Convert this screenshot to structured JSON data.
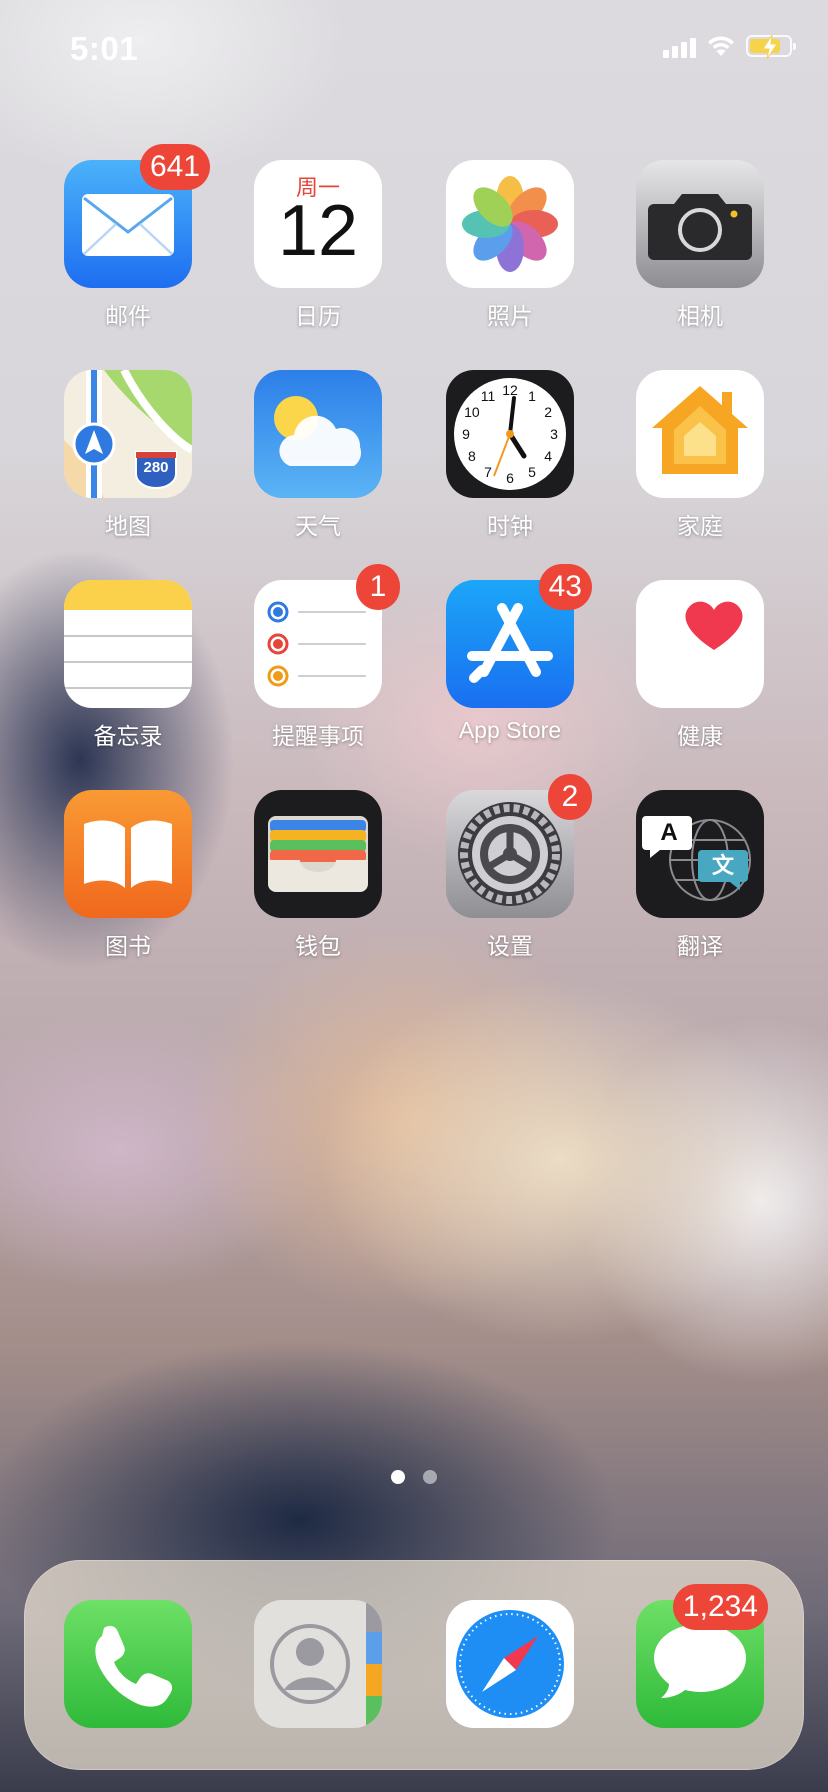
{
  "status_bar": {
    "time": "5:01"
  },
  "grid_apps": [
    {
      "label": "邮件",
      "badge": "641",
      "icon": "mail-icon"
    },
    {
      "label": "日历",
      "badge": "",
      "icon": "calendar-icon"
    },
    {
      "label": "照片",
      "badge": "",
      "icon": "photos-icon"
    },
    {
      "label": "相机",
      "badge": "",
      "icon": "camera-icon"
    },
    {
      "label": "地图",
      "badge": "",
      "icon": "maps-icon"
    },
    {
      "label": "天气",
      "badge": "",
      "icon": "weather-icon"
    },
    {
      "label": "时钟",
      "badge": "",
      "icon": "clock-icon"
    },
    {
      "label": "家庭",
      "badge": "",
      "icon": "home-icon"
    },
    {
      "label": "备忘录",
      "badge": "",
      "icon": "notes-icon"
    },
    {
      "label": "提醒事项",
      "badge": "1",
      "icon": "reminders-icon"
    },
    {
      "label": "App Store",
      "badge": "43",
      "icon": "app-store-icon"
    },
    {
      "label": "健康",
      "badge": "",
      "icon": "health-icon"
    },
    {
      "label": "图书",
      "badge": "",
      "icon": "books-icon"
    },
    {
      "label": "钱包",
      "badge": "",
      "icon": "wallet-icon"
    },
    {
      "label": "设置",
      "badge": "2",
      "icon": "settings-icon"
    },
    {
      "label": "翻译",
      "badge": "",
      "icon": "translate-icon"
    }
  ],
  "calendar_icon": {
    "weekday": "周一",
    "day": "12"
  },
  "maps_icon": {
    "shield": "280"
  },
  "clock_icon": {
    "numerals": [
      "12",
      "1",
      "2",
      "3",
      "4",
      "5",
      "6",
      "7",
      "8",
      "9",
      "10",
      "11"
    ]
  },
  "translate_icon": {
    "left_glyph": "A",
    "right_glyph": "文"
  },
  "dock_apps": [
    {
      "name": "phone",
      "badge": "",
      "icon": "phone-icon"
    },
    {
      "name": "contacts",
      "badge": "",
      "icon": "contacts-icon"
    },
    {
      "name": "safari",
      "badge": "",
      "icon": "safari-icon"
    },
    {
      "name": "messages",
      "badge": "1,234",
      "icon": "messages-icon"
    }
  ],
  "page_indicator": {
    "pages": 2,
    "current": 1
  },
  "colors": {
    "badge": "#ee4539",
    "label_text": "#ffffff",
    "battery_fill": "#f7d34a"
  }
}
